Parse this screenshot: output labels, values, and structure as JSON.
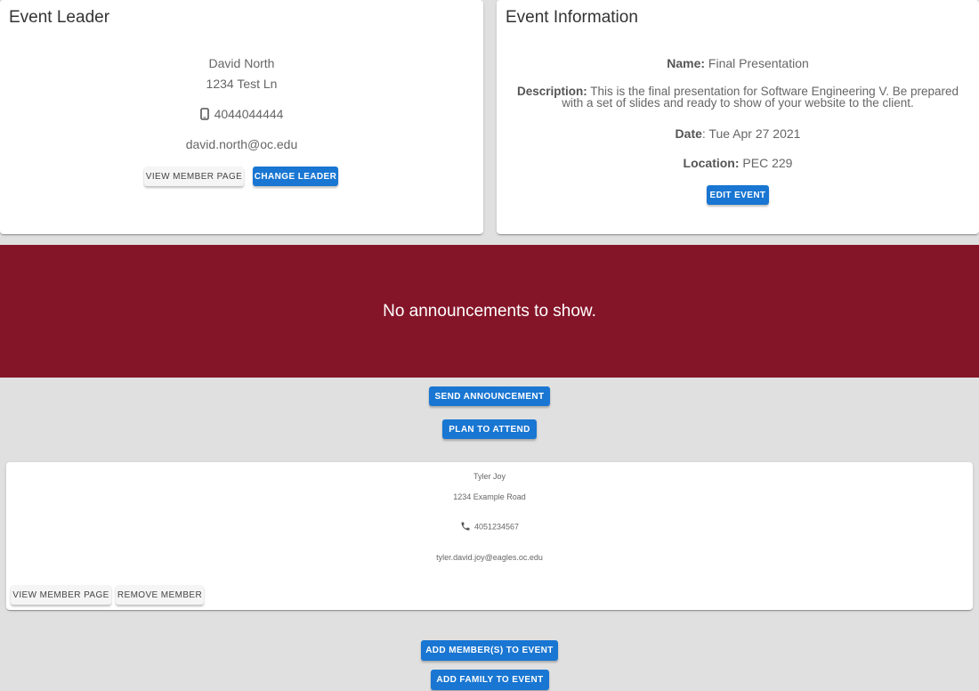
{
  "leader": {
    "title": "Event Leader",
    "name": "David North",
    "address": "1234 Test Ln",
    "phone": "4044044444",
    "email": "david.north@oc.edu",
    "view_button": "View Member Page",
    "change_button": "Change Leader"
  },
  "event": {
    "title": "Event Information",
    "name_label": "Name:",
    "name": "Final Presentation",
    "description_label": "Description:",
    "description": "This is the final presentation for Software Engineering V. Be prepared with a set of slides and ready to show of your website to the client.",
    "date_label": "Date",
    "date": ": Tue Apr 27 2021",
    "location_label": "Location:",
    "location": "PEC 229",
    "edit_button": "Edit Event"
  },
  "announcements": {
    "empty_text": "No announcements to show."
  },
  "actions": {
    "send_announcement": "Send Announcement",
    "plan_to_attend": "Plan to Attend",
    "add_members": "Add Member(s) to Event",
    "add_family": "Add Family to Event"
  },
  "member": {
    "name": "Tyler Joy",
    "address": "1234 Example Road",
    "phone": "4051234567",
    "email": "tyler.david.joy@eagles.oc.edu",
    "view_button": "View Member Page",
    "remove_button": "Remove Member"
  },
  "colors": {
    "primary": "#1976d2",
    "banner": "#841428",
    "background": "#e0e0e0"
  }
}
